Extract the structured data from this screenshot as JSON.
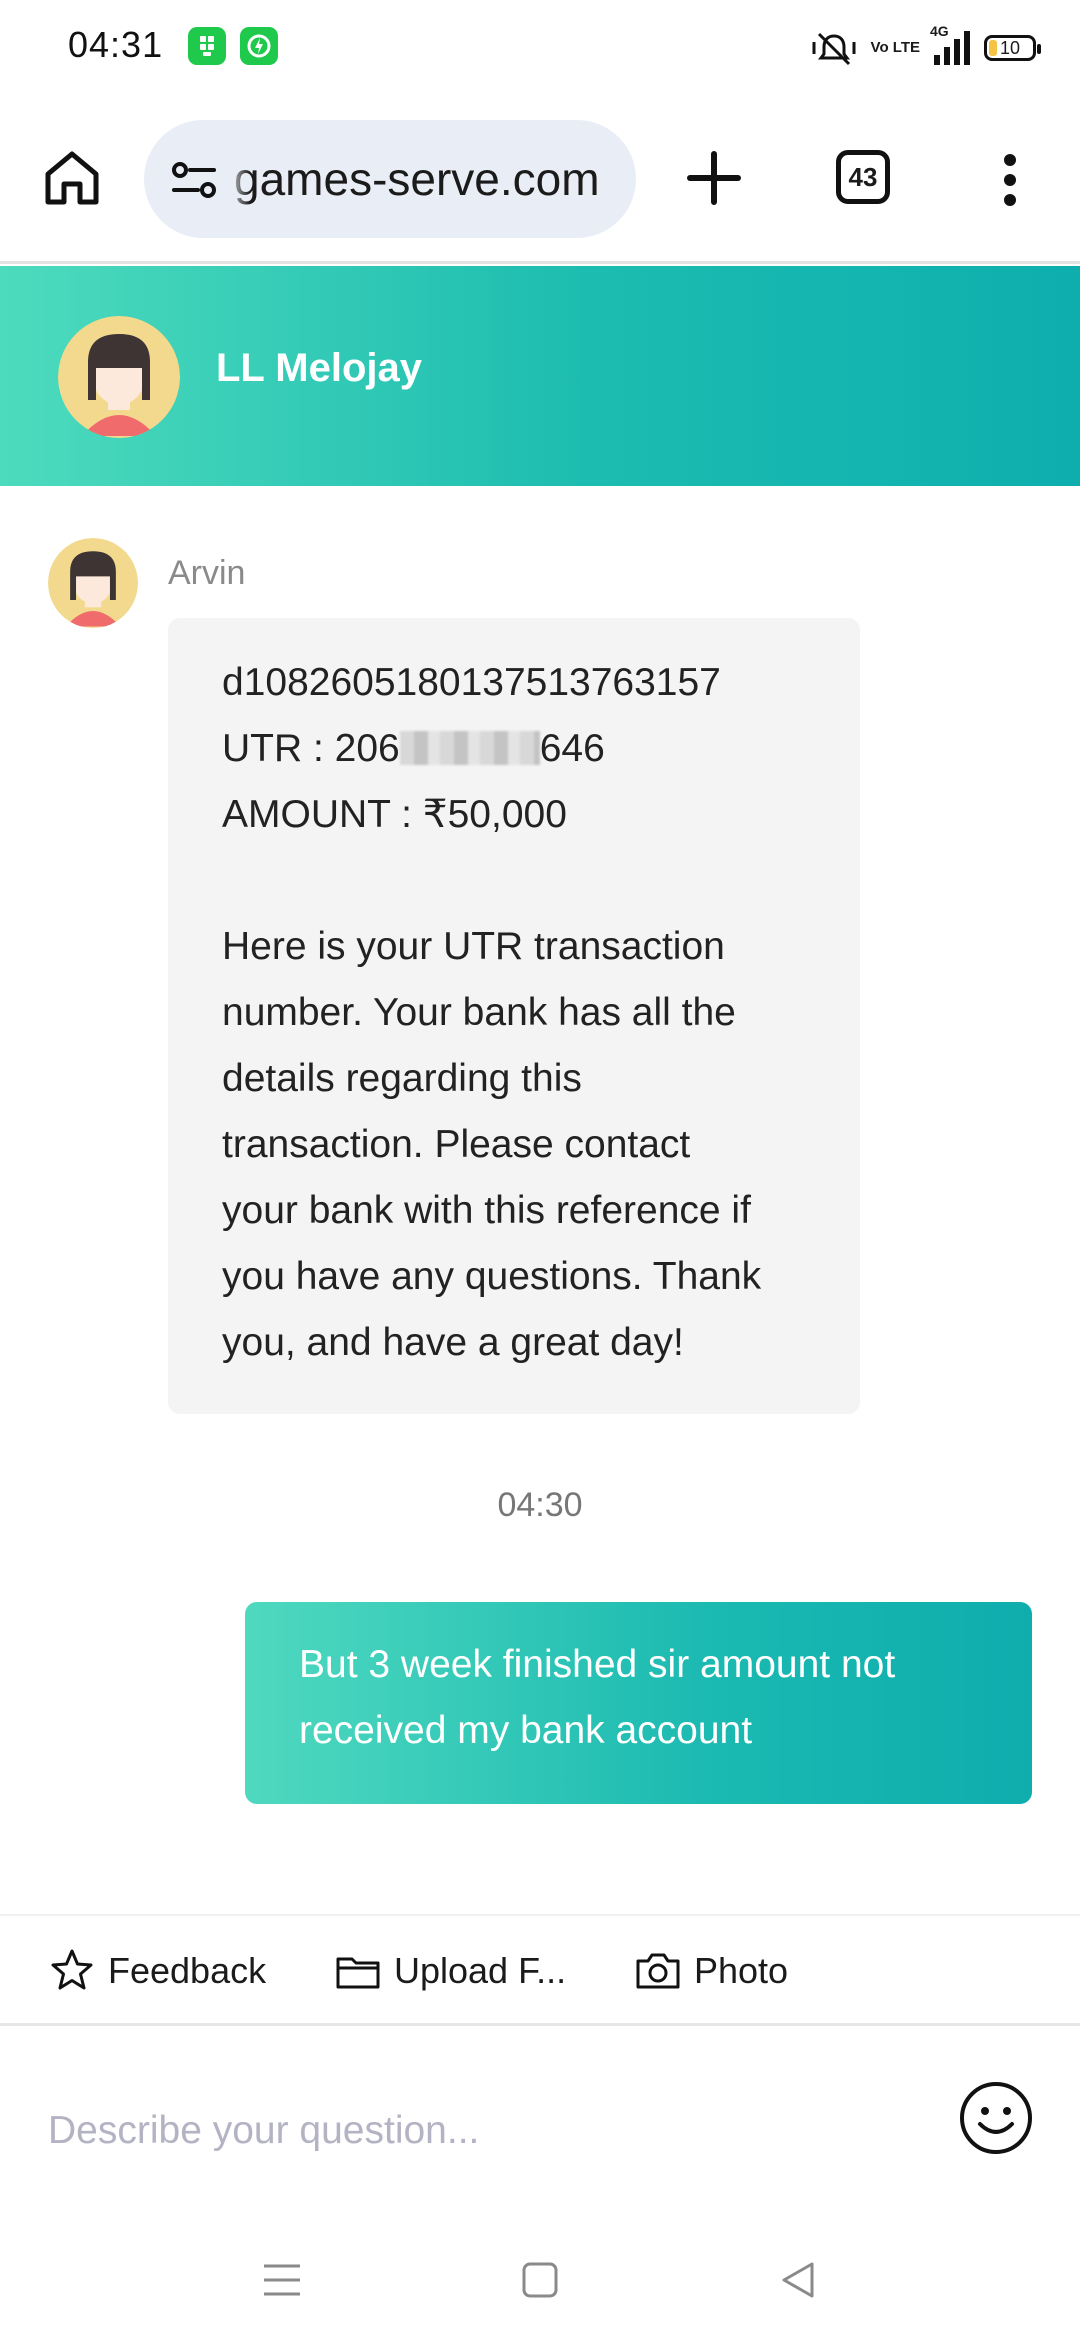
{
  "status_bar": {
    "time": "04:31",
    "battery": "10",
    "network": "4G",
    "volte": "Vo LTE",
    "icons": [
      "app-badge-icon",
      "shield-badge-icon",
      "mute-vibrate-icon",
      "volte-icon",
      "signal-icon",
      "battery-icon"
    ]
  },
  "browser": {
    "url": "games-serve.com",
    "tab_count": "43",
    "icons": [
      "home-icon",
      "site-settings-icon",
      "plus-icon",
      "tabs-icon",
      "more-vert-icon"
    ]
  },
  "chat": {
    "header_title": "LL Melojay",
    "messages": [
      {
        "sender": "Arvin",
        "line1": "d1082605180137513763157",
        "utr_prefix": "UTR : 206",
        "utr_suffix": "646",
        "amount": "AMOUNT : ₹50,000",
        "body_lines": [
          "Here is your UTR transaction",
          "number. Your bank has all the",
          "details regarding this",
          "transaction. Please contact",
          "your bank with this reference if",
          "you have any questions. Thank",
          "you, and have a great day!"
        ]
      }
    ],
    "timestamp": "04:30",
    "user_message_lines": [
      "But 3 week finished sir amount not",
      "received my bank account"
    ]
  },
  "toolbar": {
    "feedback": "Feedback",
    "upload": "Upload F...",
    "photo": "Photo"
  },
  "input": {
    "placeholder": "Describe your question..."
  },
  "colors": {
    "header_gradient_start": "#4ddbbd",
    "header_gradient_end": "#0eaeaf",
    "bubble_in": "#f4f4f4",
    "url_bar": "#e9edf6"
  }
}
